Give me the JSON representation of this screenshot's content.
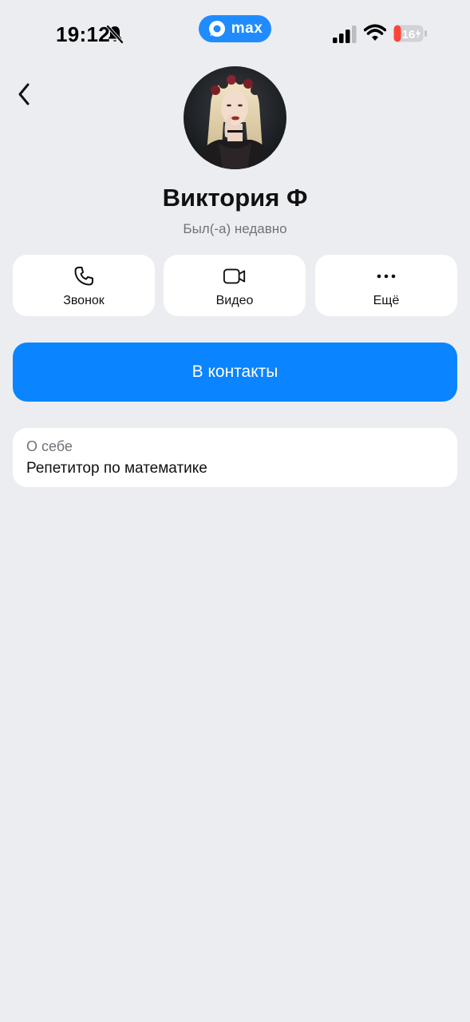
{
  "status_bar": {
    "time": "19:12",
    "app_badge": "max",
    "battery_level": "16",
    "silent_mode": true,
    "accent_color": "#1f8bff"
  },
  "profile": {
    "name": "Виктория Ф",
    "status": "Был(-а) недавно",
    "avatar_icon": "user-photo"
  },
  "actions": [
    {
      "label": "Звонок",
      "icon": "phone-icon"
    },
    {
      "label": "Видео",
      "icon": "video-camera-icon"
    },
    {
      "label": "Ещё",
      "icon": "more-dots-icon"
    }
  ],
  "primary_button": {
    "label": "В контакты",
    "color": "#0a84ff"
  },
  "about": {
    "title": "О себе",
    "text": "Репетитор по математике"
  },
  "colors": {
    "background": "#ebedf1",
    "card": "#ffffff",
    "secondary_text": "#6f7378"
  }
}
